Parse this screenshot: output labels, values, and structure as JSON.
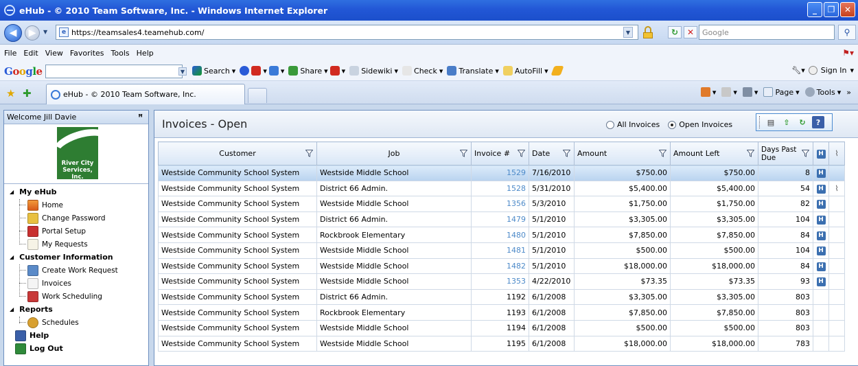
{
  "browser": {
    "window_title": "eHub - © 2010 Team Software, Inc. - Windows Internet Explorer",
    "url": "https://teamsales4.teamehub.com/",
    "search_placeholder": "Google",
    "menu": [
      "File",
      "Edit",
      "View",
      "Favorites",
      "Tools",
      "Help"
    ],
    "google_logo": [
      "G",
      "o",
      "o",
      "g",
      "l",
      "e"
    ],
    "google_tools": [
      "Search",
      "Share",
      "Sidewiki",
      "Check",
      "Translate",
      "AutoFill"
    ],
    "sign_in": "Sign In",
    "tab_title": "eHub - © 2010 Team Software, Inc.",
    "commands": [
      "Page",
      "Tools"
    ]
  },
  "sidebar": {
    "welcome": "Welcome Jill Davie",
    "logo_text": "River City Services, Inc.",
    "groups": [
      {
        "label": "My eHub",
        "items": [
          "Home",
          "Change Password",
          "Portal Setup",
          "My Requests"
        ]
      },
      {
        "label": "Customer Information",
        "items": [
          "Create Work Request",
          "Invoices",
          "Work Scheduling"
        ]
      },
      {
        "label": "Reports",
        "items": [
          "Schedules"
        ]
      }
    ],
    "help": "Help",
    "logout": "Log Out"
  },
  "main": {
    "title": "Invoices - Open",
    "radio_all": "All Invoices",
    "radio_open": "Open Invoices",
    "selected_filter": "Open Invoices",
    "columns": [
      "Customer",
      "Job",
      "Invoice #",
      "Date",
      "Amount",
      "Amount Left",
      "Days Past Due"
    ],
    "rows": [
      {
        "customer": "Westside Community School System",
        "job": "Westside Middle School",
        "invoice": "1529",
        "date": "7/16/2010",
        "amount": "$750.00",
        "amount_left": "$750.00",
        "days": "8",
        "h": true,
        "attach": false,
        "link": true
      },
      {
        "customer": "Westside Community School System",
        "job": "District 66 Admin.",
        "invoice": "1528",
        "date": "5/31/2010",
        "amount": "$5,400.00",
        "amount_left": "$5,400.00",
        "days": "54",
        "h": true,
        "attach": true,
        "link": true
      },
      {
        "customer": "Westside Community School System",
        "job": "Westside Middle School",
        "invoice": "1356",
        "date": "5/3/2010",
        "amount": "$1,750.00",
        "amount_left": "$1,750.00",
        "days": "82",
        "h": true,
        "attach": false,
        "link": true
      },
      {
        "customer": "Westside Community School System",
        "job": "District 66 Admin.",
        "invoice": "1479",
        "date": "5/1/2010",
        "amount": "$3,305.00",
        "amount_left": "$3,305.00",
        "days": "104",
        "h": true,
        "attach": false,
        "link": true
      },
      {
        "customer": "Westside Community School System",
        "job": "Rockbrook Elementary",
        "invoice": "1480",
        "date": "5/1/2010",
        "amount": "$7,850.00",
        "amount_left": "$7,850.00",
        "days": "84",
        "h": true,
        "attach": false,
        "link": true
      },
      {
        "customer": "Westside Community School System",
        "job": "Westside Middle School",
        "invoice": "1481",
        "date": "5/1/2010",
        "amount": "$500.00",
        "amount_left": "$500.00",
        "days": "104",
        "h": true,
        "attach": false,
        "link": true
      },
      {
        "customer": "Westside Community School System",
        "job": "Westside Middle School",
        "invoice": "1482",
        "date": "5/1/2010",
        "amount": "$18,000.00",
        "amount_left": "$18,000.00",
        "days": "84",
        "h": true,
        "attach": false,
        "link": true
      },
      {
        "customer": "Westside Community School System",
        "job": "Westside Middle School",
        "invoice": "1353",
        "date": "4/22/2010",
        "amount": "$73.35",
        "amount_left": "$73.35",
        "days": "93",
        "h": true,
        "attach": false,
        "link": true
      },
      {
        "customer": "Westside Community School System",
        "job": "District 66 Admin.",
        "invoice": "1192",
        "date": "6/1/2008",
        "amount": "$3,305.00",
        "amount_left": "$3,305.00",
        "days": "803",
        "h": false,
        "attach": false,
        "link": false
      },
      {
        "customer": "Westside Community School System",
        "job": "Rockbrook Elementary",
        "invoice": "1193",
        "date": "6/1/2008",
        "amount": "$7,850.00",
        "amount_left": "$7,850.00",
        "days": "803",
        "h": false,
        "attach": false,
        "link": false
      },
      {
        "customer": "Westside Community School System",
        "job": "Westside Middle School",
        "invoice": "1194",
        "date": "6/1/2008",
        "amount": "$500.00",
        "amount_left": "$500.00",
        "days": "803",
        "h": false,
        "attach": false,
        "link": false
      },
      {
        "customer": "Westside Community School System",
        "job": "Westside Middle School",
        "invoice": "1195",
        "date": "6/1/2008",
        "amount": "$18,000.00",
        "amount_left": "$18,000.00",
        "days": "783",
        "h": false,
        "attach": false,
        "link": false
      }
    ]
  }
}
